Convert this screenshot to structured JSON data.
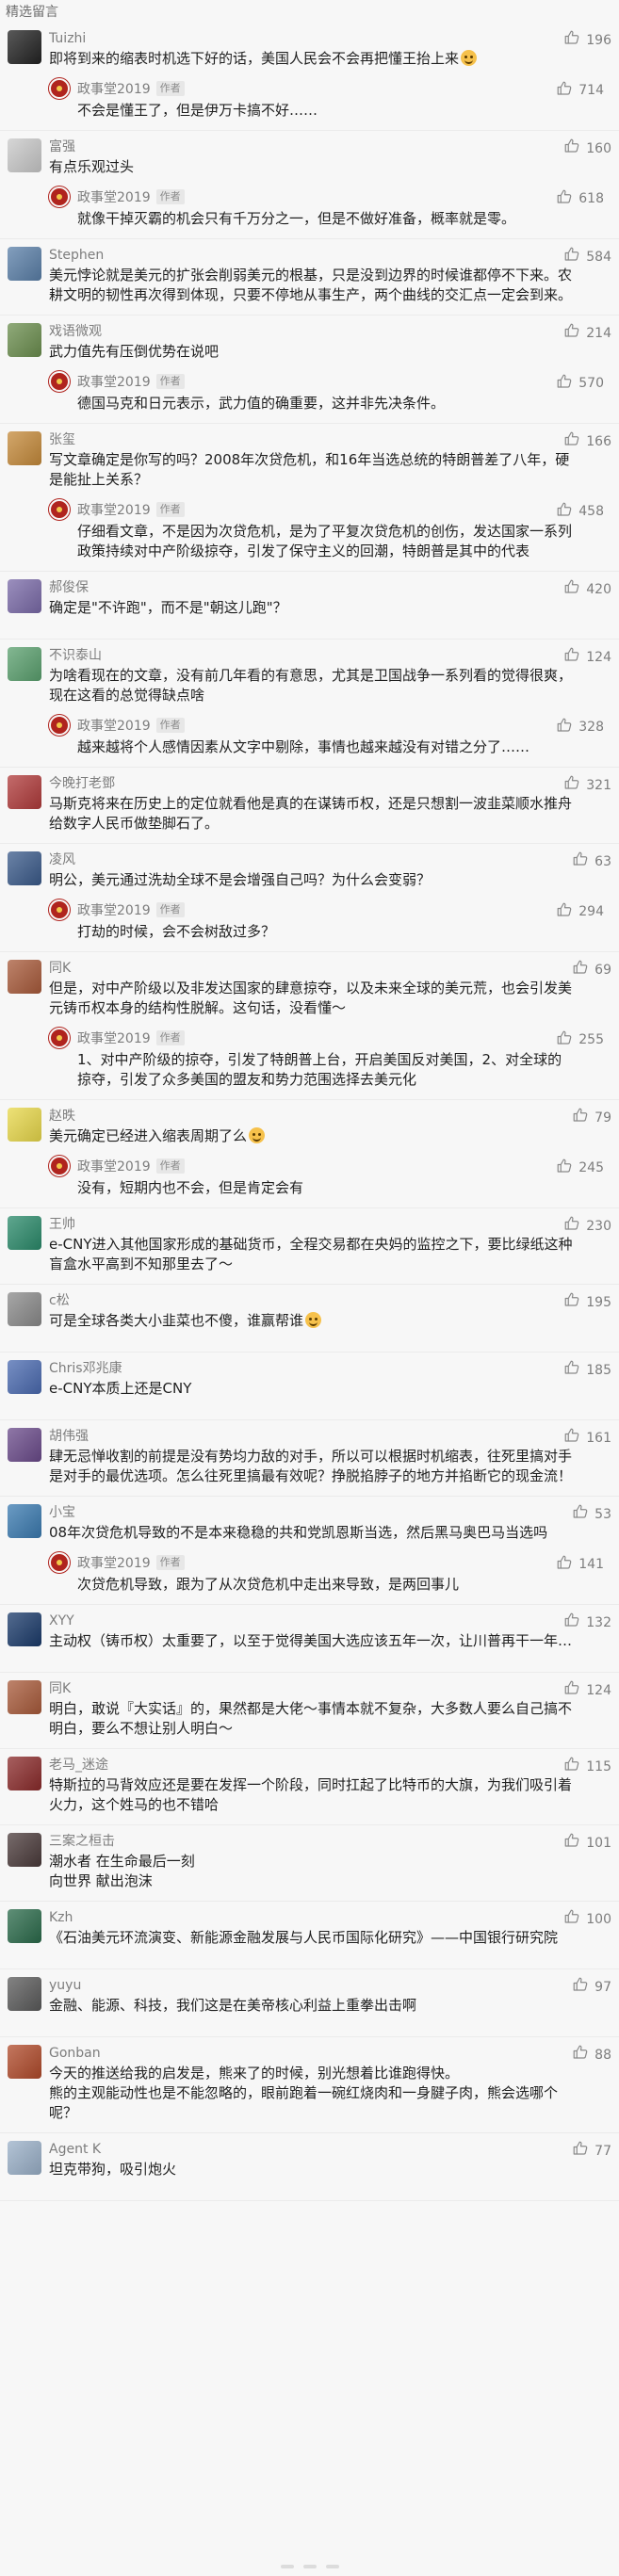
{
  "header": {
    "title": "精选留言"
  },
  "comments": [
    {
      "nick": "Tuizhi",
      "likes": "196",
      "content": "即将到来的缩表时机选下好的话，美国人民会不会再把懂王抬上来",
      "emoji": true,
      "avatar_color": "#222222",
      "reply": {
        "name": "政事堂2019",
        "tag": "作者",
        "likes": "714",
        "content": "不会是懂王了，但是伊万卡搞不好……"
      }
    },
    {
      "nick": "富强",
      "likes": "160",
      "content": "有点乐观过头",
      "avatar_color": "#c9c9c9",
      "reply": {
        "name": "政事堂2019",
        "tag": "作者",
        "likes": "618",
        "content": "就像干掉灭霸的机会只有千万分之一，但是不做好准备，概率就是零。"
      }
    },
    {
      "nick": "Stephen",
      "likes": "584",
      "content": "美元悖论就是美元的扩张会削弱美元的根基，只是没到边界的时候谁都停不下来。农耕文明的韧性再次得到体现，只要不停地从事生产，两个曲线的交汇点一定会到来。",
      "avatar_color": "#5a7fa8"
    },
    {
      "nick": "戏语微观",
      "likes": "214",
      "content": "武力值先有压倒优势在说吧",
      "avatar_color": "#6b8e4e",
      "reply": {
        "name": "政事堂2019",
        "tag": "作者",
        "likes": "570",
        "content": "德国马克和日元表示，武力值的确重要，这并非先决条件。"
      }
    },
    {
      "nick": "张玺",
      "likes": "166",
      "content": "写文章确定是你写的吗？2008年次贷危机，和16年当选总统的特朗普差了八年，硬是能扯上关系？",
      "avatar_color": "#c58a3a",
      "reply": {
        "name": "政事堂2019",
        "tag": "作者",
        "likes": "458",
        "content": "仔细看文章，不是因为次贷危机，是为了平复次贷危机的创伤，发达国家一系列政策持续对中产阶级掠夺，引发了保守主义的回潮，特朗普是其中的代表"
      }
    },
    {
      "nick": "郝俊保",
      "likes": "420",
      "content": "确定是\"不许跑\"，而不是\"朝这儿跑\"？",
      "avatar_color": "#7a6aa8"
    },
    {
      "nick": "不识泰山",
      "likes": "124",
      "content": "为啥看现在的文章，没有前几年看的有意思，尤其是卫国战争一系列看的觉得很爽，现在这看的总觉得缺点啥",
      "avatar_color": "#5aa06e",
      "reply": {
        "name": "政事堂2019",
        "tag": "作者",
        "likes": "328",
        "content": "越来越将个人感情因素从文字中剔除，事情也越来越没有对错之分了……"
      }
    },
    {
      "nick": "今晚打老鄧",
      "likes": "321",
      "content": "马斯克将来在历史上的定位就看他是真的在谋铸币权，还是只想割一波韭菜顺水推舟给数字人民币做垫脚石了。",
      "avatar_color": "#b03a3a"
    },
    {
      "nick": "凌风",
      "likes": "63",
      "content": "明公，美元通过洗劫全球不是会增强自己吗？为什么会变弱？",
      "avatar_color": "#3a5a8a",
      "reply": {
        "name": "政事堂2019",
        "tag": "作者",
        "likes": "294",
        "content": "打劫的时候，会不会树敌过多？"
      }
    },
    {
      "nick": "同K",
      "likes": "69",
      "content": "但是，对中产阶级以及非发达国家的肆意掠夺，以及未来全球的美元荒，也会引发美元铸币权本身的结构性脱解。这句话，没看懂～",
      "avatar_color": "#a85a3a",
      "reply": {
        "name": "政事堂2019",
        "tag": "作者",
        "likes": "255",
        "content": "1、对中产阶级的掠夺，引发了特朗普上台，开启美国反对美国，2、对全球的掠夺，引发了众多美国的盟友和势力范围选择去美元化"
      }
    },
    {
      "nick": "赵昳",
      "likes": "79",
      "content": "美元确定已经进入缩表周期了么",
      "emoji": true,
      "avatar_color": "#e8d84a",
      "reply": {
        "name": "政事堂2019",
        "tag": "作者",
        "likes": "245",
        "content": "没有，短期内也不会，但是肯定会有"
      }
    },
    {
      "nick": "王帅",
      "likes": "230",
      "content": "e-CNY进入其他国家形成的基础货币，全程交易都在央妈的监控之下，要比绿纸这种盲盒水平高到不知那里去了～",
      "avatar_color": "#2a8a6a"
    },
    {
      "nick": "c松",
      "likes": "195",
      "content": "可是全球各类大小韭菜也不傻，谁赢帮谁",
      "emoji": true,
      "avatar_color": "#8a8a8a"
    },
    {
      "nick": "Chris邓兆康",
      "likes": "185",
      "content": "e-CNY本质上还是CNY",
      "avatar_color": "#4a6ab0"
    },
    {
      "nick": "胡伟强",
      "likes": "161",
      "content": "肆无忌惮收割的前提是没有势均力敌的对手，所以可以根据时机缩表，往死里搞对手是对手的最优选项。怎么往死里搞最有效呢？挣脱掐脖子的地方并掐断它的现金流！",
      "avatar_color": "#6a4a8a"
    },
    {
      "nick": "小宝",
      "likes": "53",
      "content": "08年次贷危机导致的不是本来稳稳的共和党凯恩斯当选，然后黑马奥巴马当选吗",
      "avatar_color": "#3a7ab0",
      "reply": {
        "name": "政事堂2019",
        "tag": "作者",
        "likes": "141",
        "content": "次贷危机导致，跟为了从次贷危机中走出来导致，是两回事儿"
      }
    },
    {
      "nick": "XYY",
      "likes": "132",
      "content": "主动权（铸币权）太重要了，以至于觉得美国大选应该五年一次，让川普再干一年…",
      "avatar_color": "#1a3a6a"
    },
    {
      "nick": "同K",
      "likes": "124",
      "content": "明白，敢说『大实话』的，果然都是大佬～事情本就不复杂，大多数人要么自己搞不明白，要么不想让别人明白～",
      "avatar_color": "#a85a3a"
    },
    {
      "nick": "老马_迷途",
      "likes": "115",
      "content": "特斯拉的马背效应还是要在发挥一个阶段，同时扛起了比特币的大旗，为我们吸引着火力，这个姓马的也不错哈",
      "avatar_color": "#8a2a2a"
    },
    {
      "nick": "三案之桓击",
      "likes": "101",
      "content": "潮水者 在生命最后一刻\n向世界 献出泡沫",
      "avatar_color": "#4a3a3a"
    },
    {
      "nick": "Kzh",
      "likes": "100",
      "content": "《石油美元环流演变、新能源金融发展与人民币国际化研究》——中国银行研究院",
      "avatar_color": "#2a6a4a"
    },
    {
      "nick": "yuyu",
      "likes": "97",
      "content": "金融、能源、科技，我们这是在美帝核心利益上重拳出击啊",
      "avatar_color": "#5a5a5a"
    },
    {
      "nick": "Gonban",
      "likes": "88",
      "content": "今天的推送给我的启发是，熊来了的时候，别光想着比谁跑得快。\n熊的主观能动性也是不能忽略的，眼前跑着一碗红烧肉和一身腱子肉，熊会选哪个呢？",
      "avatar_color": "#b04a2a"
    },
    {
      "nick": "Agent K",
      "likes": "77",
      "content": "坦克带狗，吸引炮火",
      "avatar_color": "#9ab0c8"
    }
  ]
}
